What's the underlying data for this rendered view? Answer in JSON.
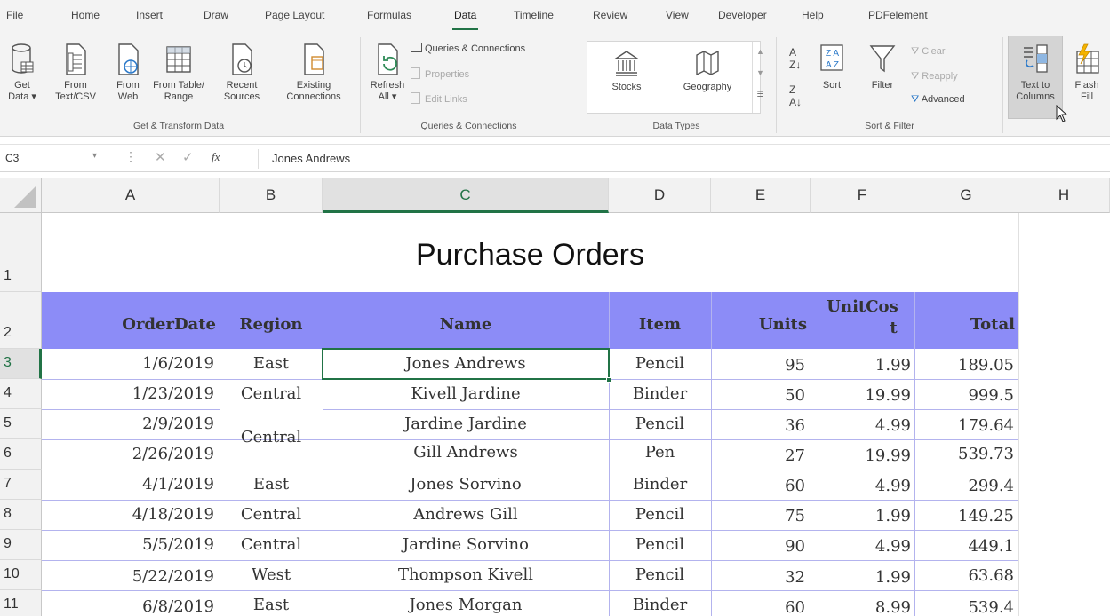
{
  "menu": {
    "tabs": [
      "File",
      "Home",
      "Insert",
      "Draw",
      "Page Layout",
      "Formulas",
      "Data",
      "Timeline",
      "Review",
      "View",
      "Developer",
      "Help",
      "PDFelement"
    ],
    "active": "Data"
  },
  "ribbon": {
    "get_transform": {
      "get_data": [
        "Get",
        "Data ▾"
      ],
      "from_text": [
        "From",
        "Text/CSV"
      ],
      "from_web": [
        "From",
        "Web"
      ],
      "from_table": [
        "From Table/",
        "Range"
      ],
      "recent": [
        "Recent",
        "Sources"
      ],
      "existing": [
        "Existing",
        "Connections"
      ],
      "group_label": "Get & Transform Data"
    },
    "queries": {
      "refresh": [
        "Refresh",
        "All ▾"
      ],
      "queries_connections": "Queries & Connections",
      "properties": "Properties",
      "edit_links": "Edit Links",
      "group_label": "Queries & Connections"
    },
    "data_types": {
      "stocks": "Stocks",
      "geography": "Geography",
      "group_label": "Data Types"
    },
    "sort_filter": {
      "sort": "Sort",
      "filter": "Filter",
      "clear": "Clear",
      "reapply": "Reapply",
      "advanced": "Advanced",
      "group_label": "Sort & Filter"
    },
    "data_tools": {
      "text_to_columns": [
        "Text to",
        "Columns"
      ],
      "flash_fill": [
        "Flash",
        "Fill"
      ]
    }
  },
  "formula_bar": {
    "name_box": "C3",
    "fx": "fx",
    "value": "Jones Andrews"
  },
  "columns": [
    "A",
    "B",
    "C",
    "D",
    "E",
    "F",
    "G",
    "H"
  ],
  "rows": [
    "1",
    "2",
    "3",
    "4",
    "5",
    "6",
    "7",
    "8",
    "9",
    "10",
    "11"
  ],
  "sheet": {
    "title": "Purchase Orders",
    "headers": [
      "OrderDate",
      "Region",
      "Name",
      "Item",
      "Units",
      "UnitCost",
      "Total"
    ],
    "header_unitcost_lines": [
      "UnitCos",
      "t"
    ],
    "data": [
      [
        "1/6/2019",
        "East",
        "Jones Andrews",
        "Pencil",
        "95",
        "1.99",
        "189.05"
      ],
      [
        "1/23/2019",
        "Central",
        "Kivell Jardine",
        "Binder",
        "50",
        "19.99",
        "999.5"
      ],
      [
        "2/9/2019",
        "Central",
        "Jardine Jardine",
        "Pencil",
        "36",
        "4.99",
        "179.64"
      ],
      [
        "2/26/2019",
        "",
        "Gill Andrews",
        "Pen",
        "27",
        "19.99",
        "539.73"
      ],
      [
        "4/1/2019",
        "East",
        "Jones Sorvino",
        "Binder",
        "60",
        "4.99",
        "299.4"
      ],
      [
        "4/18/2019",
        "Central",
        "Andrews Gill",
        "Pencil",
        "75",
        "1.99",
        "149.25"
      ],
      [
        "5/5/2019",
        "Central",
        "Jardine Sorvino",
        "Pencil",
        "90",
        "4.99",
        "449.1"
      ],
      [
        "5/22/2019",
        "West",
        "Thompson Kivell",
        "Pencil",
        "32",
        "1.99",
        "63.68"
      ],
      [
        "6/8/2019",
        "East",
        "Jones Morgan",
        "Binder",
        "60",
        "8.99",
        "539.4"
      ]
    ]
  },
  "colors": {
    "header_fill": "#8c8cf7",
    "accent": "#217346",
    "ribbon_bg": "#f3f3f3"
  }
}
